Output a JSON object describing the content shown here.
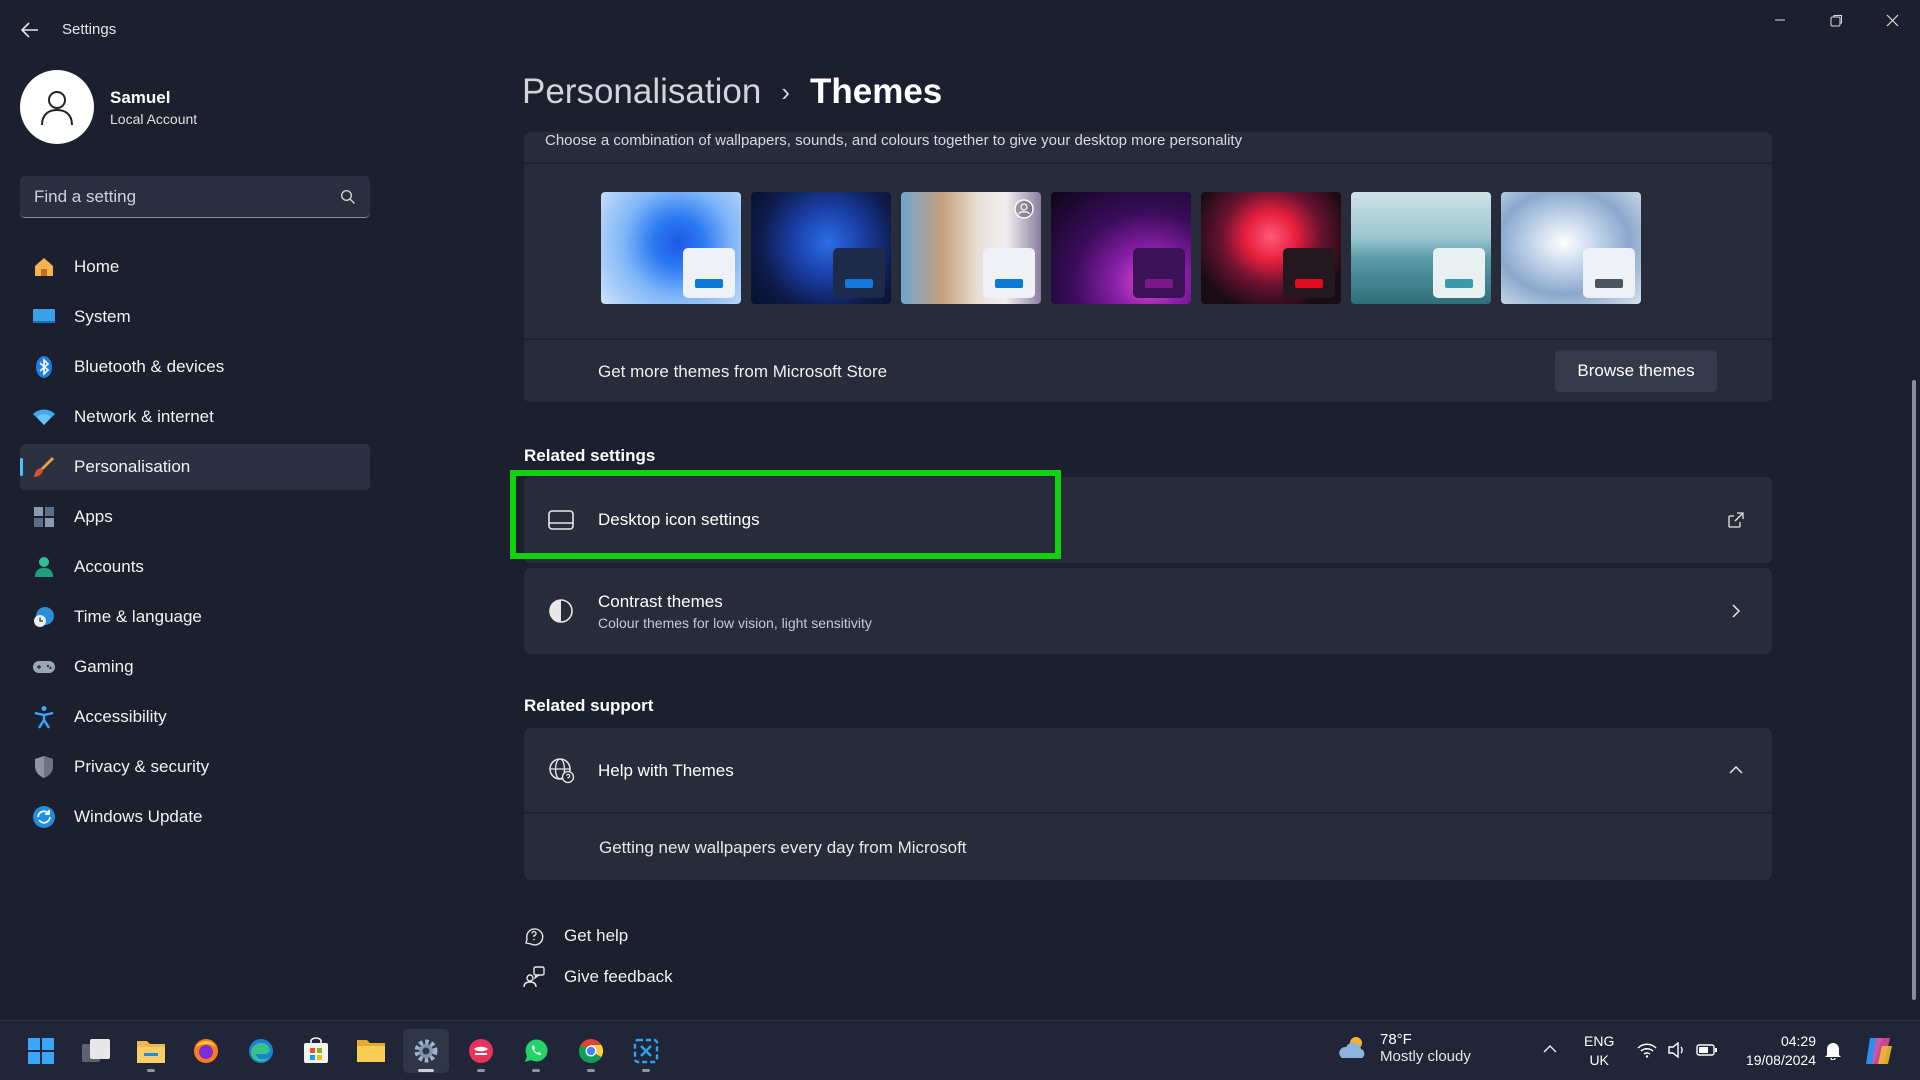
{
  "window": {
    "title": "Settings"
  },
  "profile": {
    "name": "Samuel",
    "account_type": "Local Account"
  },
  "search": {
    "placeholder": "Find a setting"
  },
  "sidebar": {
    "items": [
      {
        "label": "Home",
        "icon": "home-icon"
      },
      {
        "label": "System",
        "icon": "system-icon"
      },
      {
        "label": "Bluetooth & devices",
        "icon": "bluetooth-icon"
      },
      {
        "label": "Network & internet",
        "icon": "wifi-icon"
      },
      {
        "label": "Personalisation",
        "icon": "brush-icon",
        "active": true
      },
      {
        "label": "Apps",
        "icon": "apps-icon"
      },
      {
        "label": "Accounts",
        "icon": "accounts-icon"
      },
      {
        "label": "Time & language",
        "icon": "time-language-icon"
      },
      {
        "label": "Gaming",
        "icon": "gamepad-icon"
      },
      {
        "label": "Accessibility",
        "icon": "accessibility-icon"
      },
      {
        "label": "Privacy & security",
        "icon": "shield-icon"
      },
      {
        "label": "Windows Update",
        "icon": "update-icon"
      }
    ]
  },
  "breadcrumb": {
    "parent": "Personalisation",
    "separator": "›",
    "current": "Themes"
  },
  "themes": {
    "description": "Choose a combination of wallpapers, sounds, and colours together to give your desktop more personality",
    "thumbnails": [
      {
        "name": "windows-light",
        "accent": "#0a78d4"
      },
      {
        "name": "windows-dark",
        "accent": "#1478d8"
      },
      {
        "name": "spotlight",
        "accent": "#0a78d4"
      },
      {
        "name": "glow",
        "accent": "#7a1a8a"
      },
      {
        "name": "captured-motion",
        "accent": "#e00b1c"
      },
      {
        "name": "sunrise",
        "accent": "#3a9aaa"
      },
      {
        "name": "flow",
        "accent": "#4a5560"
      }
    ],
    "store_text": "Get more themes from Microsoft Store",
    "browse_button": "Browse themes"
  },
  "related_settings": {
    "title": "Related settings",
    "items": [
      {
        "label": "Desktop icon settings",
        "icon": "monitor-icon",
        "action_icon": "open-external-icon"
      },
      {
        "label": "Contrast themes",
        "sublabel": "Colour themes for low vision, light sensitivity",
        "icon": "contrast-icon",
        "action_icon": "chevron-right-icon"
      }
    ]
  },
  "related_support": {
    "title": "Related support",
    "help_title": "Help with Themes",
    "help_link": "Getting new wallpapers every day from Microsoft"
  },
  "footer": {
    "get_help": "Get help",
    "give_feedback": "Give feedback"
  },
  "taskbar": {
    "weather_temp": "78°F",
    "weather_desc": "Mostly cloudy",
    "lang_line1": "ENG",
    "lang_line2": "UK",
    "time": "04:29",
    "date": "19/08/2024"
  },
  "colors": {
    "accent": "#4cc2ff",
    "highlight": "#0ed30e"
  }
}
